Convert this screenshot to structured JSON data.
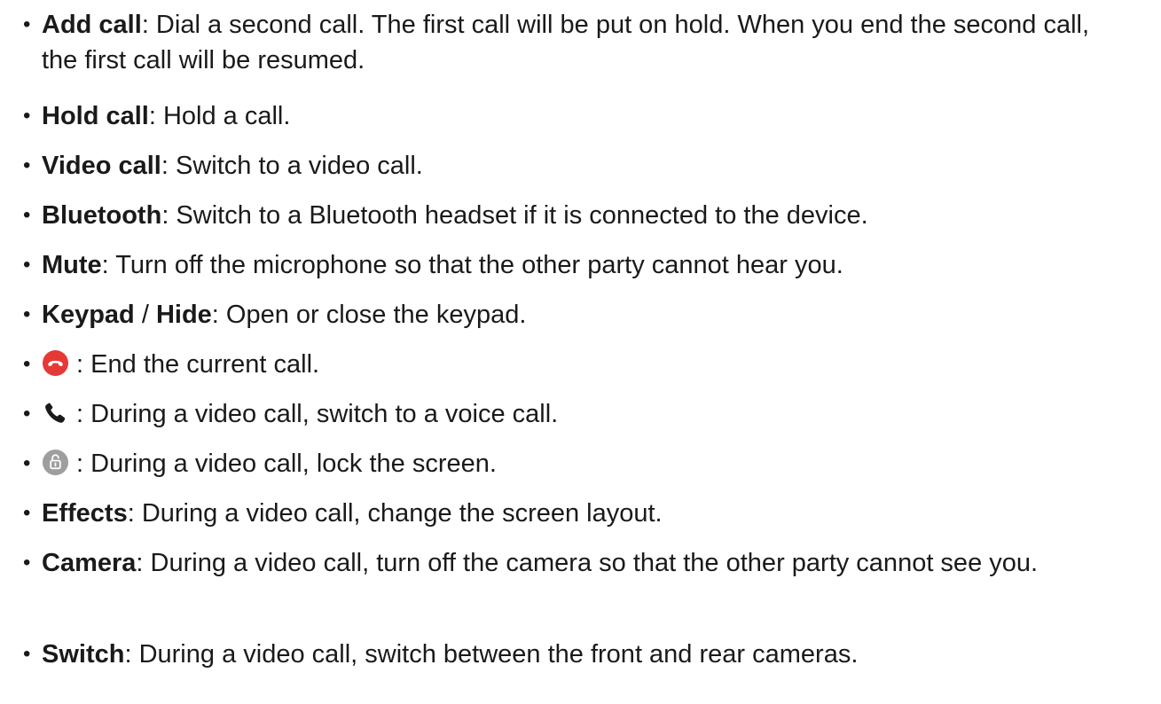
{
  "bullet": "•",
  "items": [
    {
      "term": "Add call",
      "desc": ": Dial a second call. The first call will be put on hold. When you end the second call, the first call will be resumed."
    },
    {
      "term": "Hold call",
      "desc": ": Hold a call."
    },
    {
      "term": "Video call",
      "desc": ": Switch to a video call."
    },
    {
      "term": "Bluetooth",
      "desc": ": Switch to a Bluetooth headset if it is connected to the device."
    },
    {
      "term": "Mute",
      "desc": ": Turn off the microphone so that the other party cannot hear you."
    },
    {
      "term": "Keypad",
      "sep": " / ",
      "term2": "Hide",
      "desc": ": Open or close the keypad."
    },
    {
      "icon": "end-call-icon",
      "desc": " : End the current call."
    },
    {
      "icon": "voice-call-icon",
      "desc": " : During a video call, switch to a voice call."
    },
    {
      "icon": "lock-screen-icon",
      "desc": " : During a video call, lock the screen."
    },
    {
      "term": "Effects",
      "desc": ": During a video call, change the screen layout."
    },
    {
      "term": "Camera",
      "desc": ": During a video call, turn off the camera so that the other party cannot see you."
    },
    {
      "term": "Switch",
      "desc": ": During a video call, switch between the front and rear cameras."
    }
  ],
  "colors": {
    "text": "#1a1a1a",
    "end_call_red": "#e53935",
    "icon_gray": "#9e9e9e"
  }
}
